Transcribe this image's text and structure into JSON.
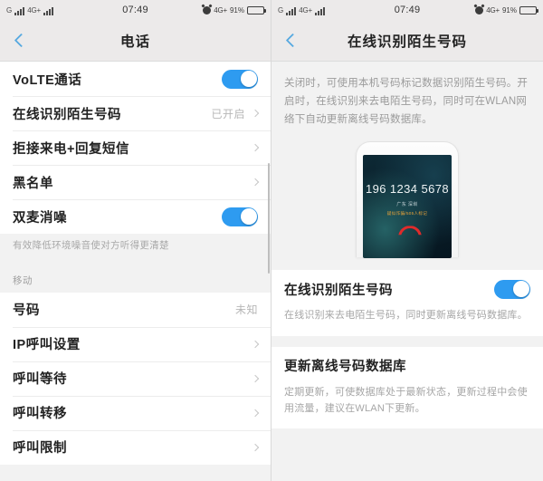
{
  "status_bar": {
    "carrier_prefix": "G",
    "network_label": "4G+",
    "clock": "07:49",
    "network_label_2": "4G+",
    "battery_percent": "91%",
    "alarm_icon": "alarm-clock-icon",
    "signal_icon": "signal-bars-icon",
    "battery_icon": "battery-icon"
  },
  "left_panel": {
    "nav": {
      "back_icon": "chevron-left-icon",
      "title": "电话"
    },
    "group_1": [
      {
        "label": "VoLTE通话",
        "control": "toggle",
        "toggle_on": true
      },
      {
        "label": "在线识别陌生号码",
        "value": "已开启",
        "control": "chevron"
      },
      {
        "label": "拒接来电+回复短信",
        "value": "",
        "control": "chevron"
      },
      {
        "label": "黑名单",
        "value": "",
        "control": "chevron"
      },
      {
        "label": "双麦消噪",
        "control": "toggle",
        "toggle_on": true
      }
    ],
    "group_1_note": "有效降低环境噪音使对方听得更清楚",
    "section_header": "移动",
    "group_2": [
      {
        "label": "号码",
        "value": "未知",
        "control": "none"
      },
      {
        "label": "IP呼叫设置",
        "value": "",
        "control": "chevron"
      },
      {
        "label": "呼叫等待",
        "value": "",
        "control": "chevron"
      },
      {
        "label": "呼叫转移",
        "value": "",
        "control": "chevron"
      },
      {
        "label": "呼叫限制",
        "value": "",
        "control": "chevron"
      }
    ]
  },
  "right_panel": {
    "nav": {
      "back_icon": "chevron-left-icon",
      "title": "在线识别陌生号码"
    },
    "description": "关闭时，可使用本机号码标记数据识别陌生号码。开启时，在线识别来去电陌生号码，同时可在WLAN网络下自动更新离线号码数据库。",
    "phone_preview": {
      "call_number": "196 1234 5678",
      "call_location": "广东 深圳",
      "call_tag": "疑似诈骗/505人标记",
      "hangup_icon": "hangup-phone-icon"
    },
    "setting_card": {
      "title": "在线识别陌生号码",
      "toggle_on": true,
      "note": "在线识别来去电陌生号码，同时更新离线号码数据库。"
    },
    "update_card": {
      "title": "更新离线号码数据库",
      "note": "定期更新，可使数据库处于最新状态，更新过程中会使用流量，建议在WLAN下更新。"
    }
  },
  "colors": {
    "accent_blue": "#2e9bf0",
    "back_arrow_blue": "#57a9e0",
    "nav_bg": "#eceaea",
    "page_bg": "#f2f2f2",
    "card_bg": "#ffffff",
    "hangup_red": "#e02b2b",
    "tag_orange": "#e8a33a"
  }
}
